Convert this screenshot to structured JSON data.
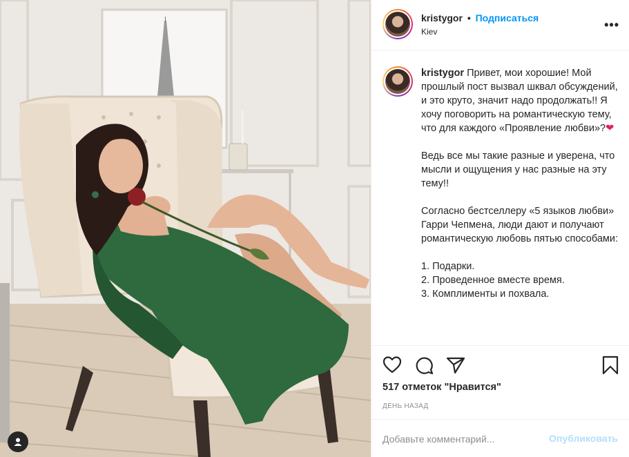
{
  "post": {
    "username": "kristygor",
    "separator": "•",
    "follow_label": "Подписаться",
    "location": "Kiev",
    "more_label": "•••"
  },
  "caption": {
    "username": "kristygor",
    "paragraphs": [
      "Привет, мои хорошие! Мой прошлый пост вызвал шквал обсуждений, и это круто, значит надо продолжать!! Я хочу поговорить на романтическую тему, что для каждого «Проявление любви»?",
      "Ведь все мы такие разные и уверена, что мысли и ощущения у нас разные на эту тему!!",
      "Согласно бестселлеру «5 языков любви» Гарри Чепмена, люди дают и получают романтическую любовь пятью способами:"
    ],
    "heart": "❤",
    "list": [
      "1. Подарки.",
      "2. Проведенное вместе время.",
      "3. Комплименты и похвала."
    ]
  },
  "stats": {
    "likes": "517 отметок \"Нравится\"",
    "time_ago": "ДЕНЬ НАЗАД"
  },
  "comment": {
    "placeholder": "Добавьте комментарий...",
    "publish_label": "Опубликовать"
  },
  "colors": {
    "accent": "#0095f6",
    "publish_disabled": "#b2dffc",
    "heart": "#e0245e"
  }
}
